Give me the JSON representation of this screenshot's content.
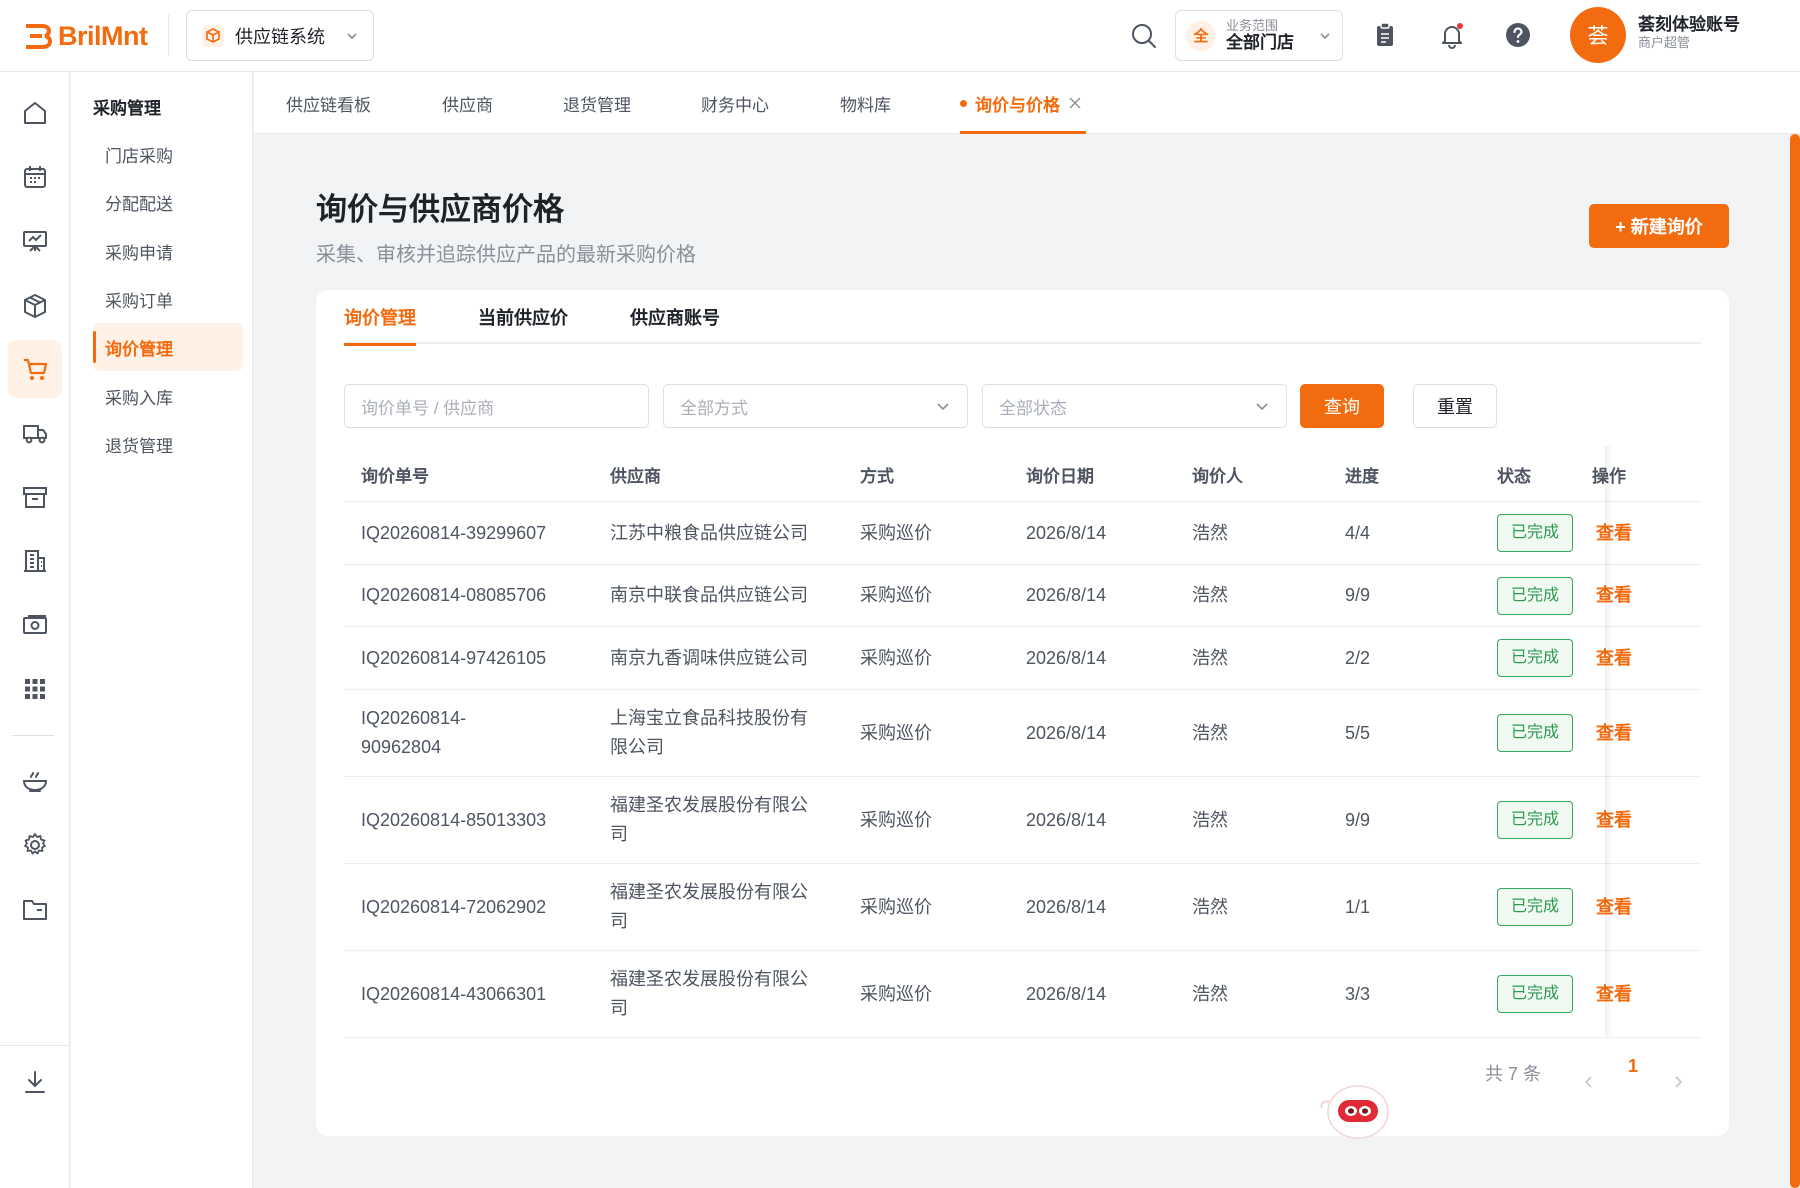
{
  "app": {
    "logo": "BrilMnt",
    "system": "供应链系统",
    "scope_label": "业务范围",
    "scope_value": "全部门店",
    "scope_badge": "全",
    "user_avatar": "荟",
    "user_name": "荟刻体验账号",
    "user_role": "商户超管",
    "accent": "#f26b0f"
  },
  "rail_icons": [
    "home-icon",
    "calendar-icon",
    "board-icon",
    "package-icon",
    "cart-icon",
    "truck-icon",
    "archive-icon",
    "building-icon",
    "money-icon",
    "grid-icon",
    "dish-icon",
    "gear-icon",
    "folder-icon",
    "download-icon"
  ],
  "subnav": {
    "title": "采购管理",
    "items": [
      "门店采购",
      "分配配送",
      "采购申请",
      "采购订单",
      "询价管理",
      "采购入库",
      "退货管理"
    ]
  },
  "tabs": [
    "供应链看板",
    "供应商",
    "退货管理",
    "财务中心",
    "物料库",
    "询价与价格"
  ],
  "page": {
    "title": "询价与供应商价格",
    "subtitle": "采集、审核并追踪供应产品的最新采购价格",
    "new_button": "+ 新建询价"
  },
  "card_tabs": [
    "询价管理",
    "当前供应价",
    "供应商账号"
  ],
  "filters": {
    "search_placeholder": "询价单号 / 供应商",
    "method_placeholder": "全部方式",
    "status_placeholder": "全部状态",
    "query": "查询",
    "reset": "重置"
  },
  "table": {
    "headers": [
      "询价单号",
      "供应商",
      "方式",
      "询价日期",
      "询价人",
      "进度",
      "状态",
      "操作"
    ],
    "rows": [
      {
        "id": "IQ20260814-39299607",
        "supplier": "江苏中粮食品供应链公司",
        "method": "采购巡价",
        "date": "2026/8/14",
        "person": "浩然",
        "progress": "4/4",
        "status": "已完成",
        "action": "查看"
      },
      {
        "id": "IQ20260814-08085706",
        "supplier": "南京中联食品供应链公司",
        "method": "采购巡价",
        "date": "2026/8/14",
        "person": "浩然",
        "progress": "9/9",
        "status": "已完成",
        "action": "查看"
      },
      {
        "id": "IQ20260814-97426105",
        "supplier": "南京九香调味供应链公司",
        "method": "采购巡价",
        "date": "2026/8/14",
        "person": "浩然",
        "progress": "2/2",
        "status": "已完成",
        "action": "查看"
      },
      {
        "id": "IQ20260814-90962804",
        "supplier": "上海宝立食品科技股份有限公司",
        "method": "采购巡价",
        "date": "2026/8/14",
        "person": "浩然",
        "progress": "5/5",
        "status": "已完成",
        "action": "查看"
      },
      {
        "id": "IQ20260814-85013303",
        "supplier": "福建圣农发展股份有限公司",
        "method": "采购巡价",
        "date": "2026/8/14",
        "person": "浩然",
        "progress": "9/9",
        "status": "已完成",
        "action": "查看"
      },
      {
        "id": "IQ20260814-72062902",
        "supplier": "福建圣农发展股份有限公司",
        "method": "采购巡价",
        "date": "2026/8/14",
        "person": "浩然",
        "progress": "1/1",
        "status": "已完成",
        "action": "查看"
      },
      {
        "id": "IQ20260814-43066301",
        "supplier": "福建圣农发展股份有限公司",
        "method": "采购巡价",
        "date": "2026/8/14",
        "person": "浩然",
        "progress": "3/3",
        "status": "已完成",
        "action": "查看"
      }
    ]
  },
  "pagination": {
    "total": "共 7 条",
    "current": "1"
  }
}
